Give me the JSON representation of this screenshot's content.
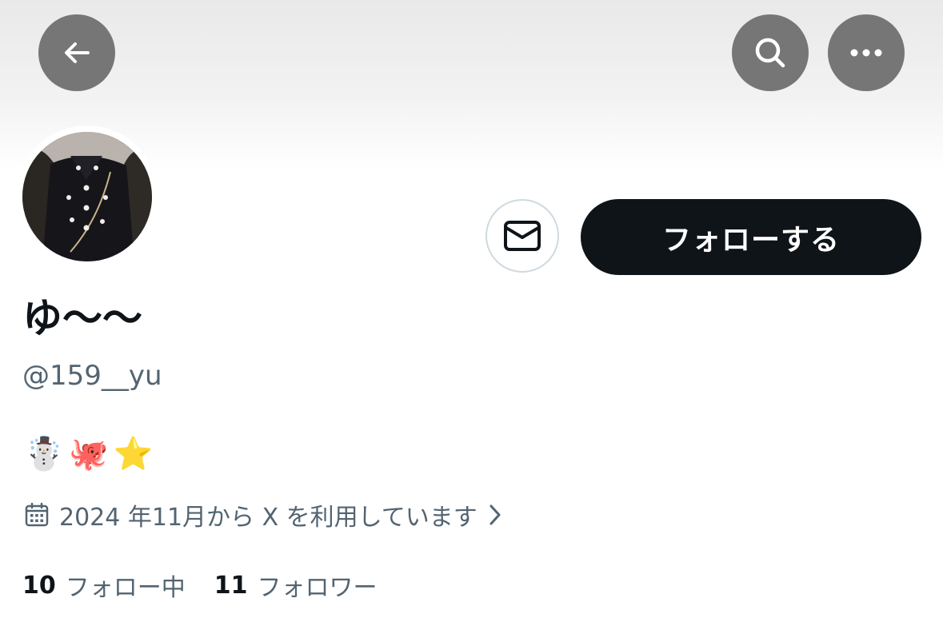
{
  "header": {
    "back_icon": "arrow-left-icon",
    "search_icon": "search-icon",
    "more_icon": "more-horizontal-icon"
  },
  "profile": {
    "display_name": "ゆ〜〜",
    "handle": "@159__yu",
    "bio_emojis": [
      "☃️",
      "🐙",
      "⭐"
    ],
    "joined": "2024 年11月から X を利用しています",
    "joined_icon": "calendar-icon",
    "following_count": "10",
    "following_label": "フォロー中",
    "followers_count": "11",
    "followers_label": "フォロワー"
  },
  "actions": {
    "message_icon": "mail-icon",
    "follow_label": "フォローする"
  },
  "colors": {
    "primary_text": "#0f1419",
    "secondary_text": "#536471",
    "button_dark": "#0f1419",
    "header_button_bg": "#767676",
    "border": "#cfd9de"
  }
}
